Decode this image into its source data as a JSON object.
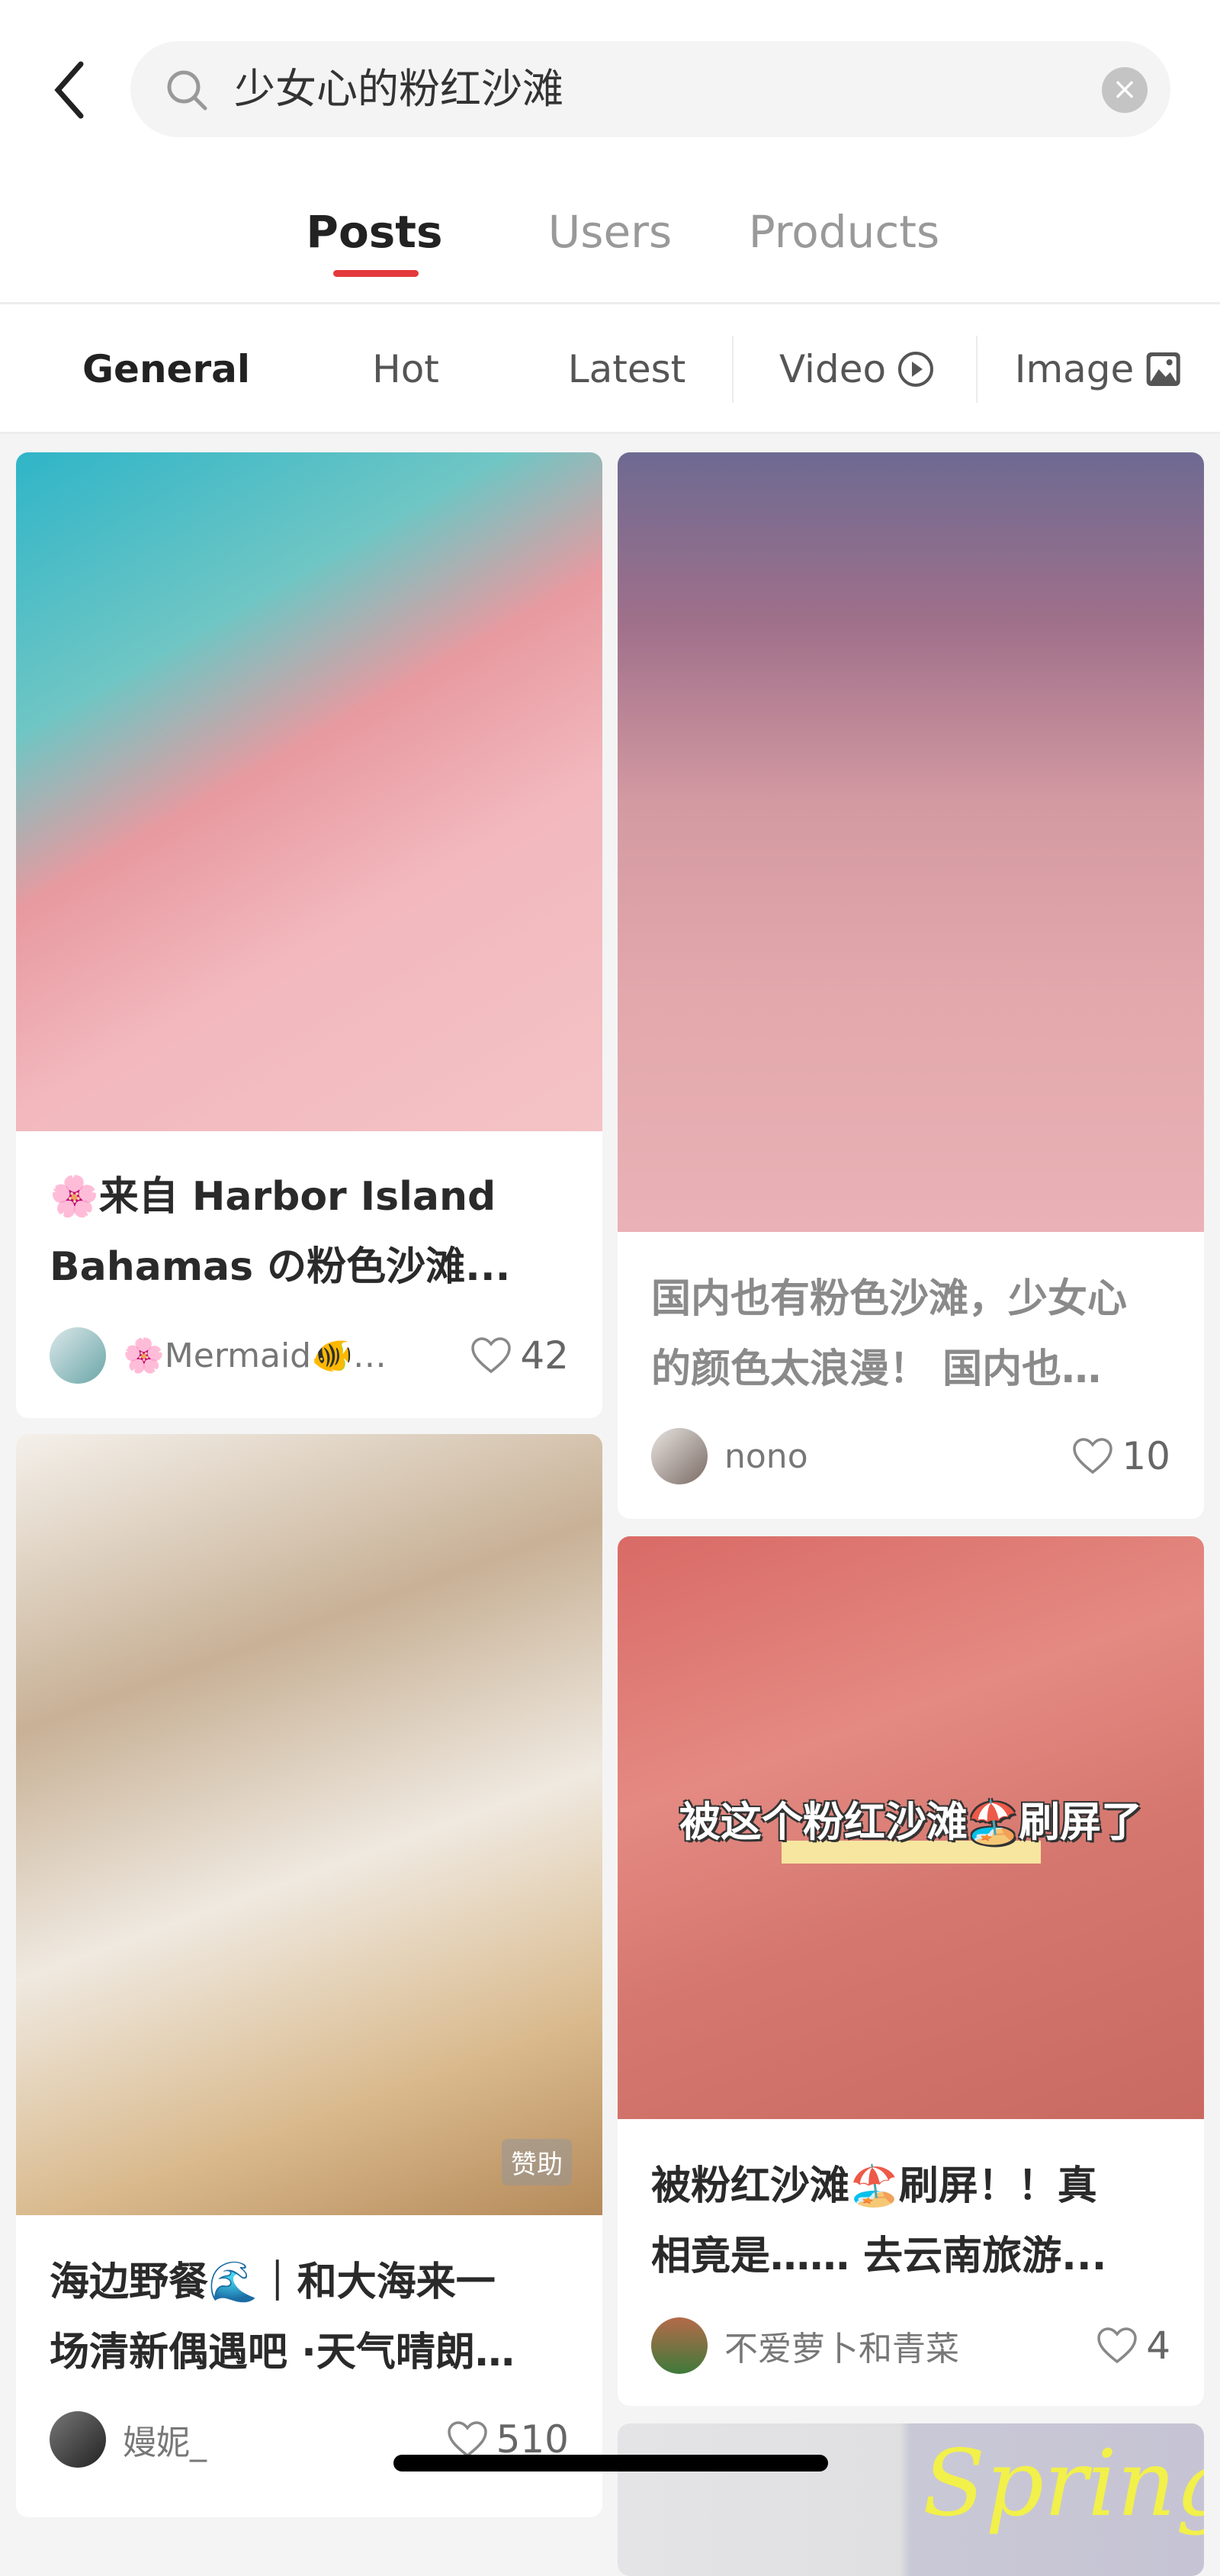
{
  "search": {
    "query": "少女心的粉红沙滩",
    "icons": [
      "back-chevron-icon",
      "search-icon",
      "clear-icon"
    ]
  },
  "tabs": [
    {
      "label": "Posts",
      "active": true
    },
    {
      "label": "Users"
    },
    {
      "label": "Products"
    }
  ],
  "accent": "#e4393c",
  "filters": [
    {
      "label": "General",
      "active": true
    },
    {
      "label": "Hot"
    },
    {
      "label": "Latest"
    },
    {
      "label": "Video",
      "icon": "play-circle-icon"
    },
    {
      "label": "Image",
      "icon": "image-icon"
    }
  ],
  "posts": [
    {
      "title_lines": [
        "🌸来自 Harbor Island",
        "Bahamas の粉色沙滩..."
      ],
      "author": "🌸Mermaid🐠…",
      "likes": "42"
    },
    {
      "title_lines": [
        "海边野餐🌊｜和大海来一",
        "场清新偶遇吧 ·天气晴朗…"
      ],
      "author": "嫚妮_",
      "likes": "510",
      "badge": "赞助"
    },
    {
      "title_lines": [
        "国内也有粉色沙滩，少女心",
        "的颜色太浪漫！ 国内也…"
      ],
      "author": "nono",
      "likes": "10"
    },
    {
      "title_lines": [
        "被粉红沙滩🏖️刷屏！！真",
        "相竟是…… 去云南旅游..."
      ],
      "author": "不爱萝卜和青菜",
      "likes": "4",
      "overlay": "被这个粉红沙滩🏖️刷屏了"
    },
    {
      "image_text": "Spring"
    }
  ]
}
